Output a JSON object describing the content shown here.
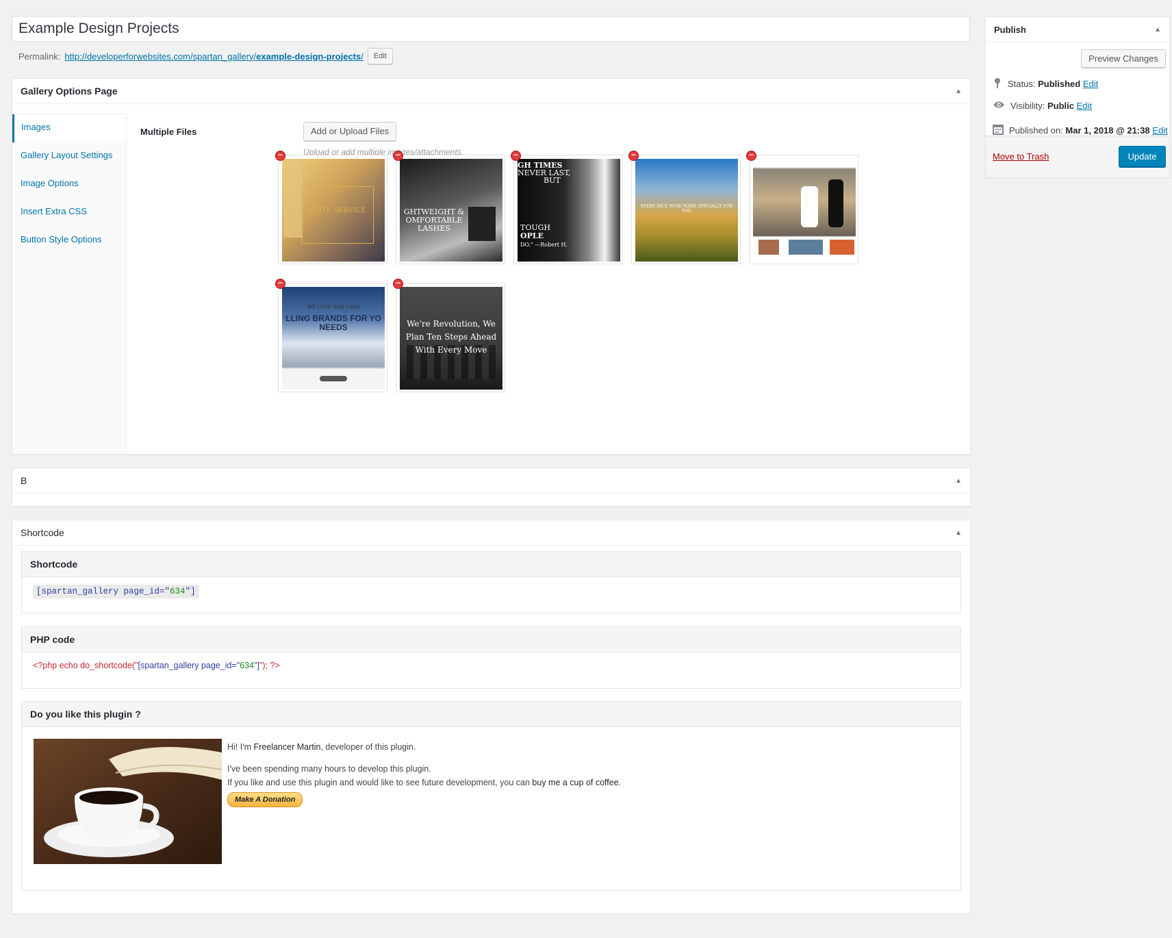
{
  "title_input": {
    "value": "Example Design Projects"
  },
  "permalink": {
    "label": "Permalink:",
    "url_base": "http://developerforwebsites.com/spartan_gallery/",
    "url_slug": "example-design-projects",
    "url_end": "/",
    "edit_label": "Edit"
  },
  "gallery_options": {
    "title": "Gallery Options Page",
    "tabs": [
      {
        "label": "Images"
      },
      {
        "label": "Gallery Layout Settings"
      },
      {
        "label": "Image Options"
      },
      {
        "label": "Insert Extra CSS"
      },
      {
        "label": "Button Style Options"
      }
    ],
    "multiple_files_label": "Multiple Files",
    "add_button": "Add or Upload Files",
    "upload_hint": "Upload or add multiple images/attachments.",
    "thumbnails": [
      {
        "texts": [
          "ELITE SERVICE"
        ],
        "colors": [
          "#d6a14a",
          "#f3d28b"
        ]
      },
      {
        "texts": [
          "GHTWEIGHT &",
          "OMFORTABLE",
          "LASHES"
        ],
        "colors": [
          "#2d2d2d",
          "#6a6a6a"
        ]
      },
      {
        "texts": [
          "GH TIMES",
          "NEVER LAST,",
          "BUT",
          "TOUGH",
          "OPLE",
          "DO.\" —Robert H."
        ],
        "colors": [
          "#111111",
          "#555555"
        ]
      },
      {
        "texts": [
          "EVERY NICE WINE MADE SPECIALLY FOR YOU"
        ],
        "colors": [
          "#2a78c4",
          "#c9a54a"
        ]
      },
      {
        "texts": [],
        "colors": [
          "#7f7a6d",
          "#d7c9a8"
        ]
      },
      {
        "texts": [
          "WE LOVE OUR CARS",
          "LLING BRANDS FOR YO",
          "NEEDS"
        ],
        "colors": [
          "#1e3f73",
          "#f1f1f1"
        ]
      },
      {
        "texts": [
          "We're Revolution, We",
          "Plan Ten Steps Ahead",
          "With Every Move"
        ],
        "colors": [
          "#3a3a3a",
          "#1c1c1c"
        ]
      }
    ]
  },
  "b_box": {
    "title": "B"
  },
  "shortcode_box": {
    "title": "Shortcode",
    "shortcode_title": "Shortcode",
    "shortcode_parts": [
      "[spartan_gallery page_id=\"",
      "634",
      "\"]"
    ],
    "php_title": "PHP code",
    "php_parts": [
      "<?php echo do_shortcode(\"",
      "[spartan_gallery page_id=\"",
      "634",
      "\"]",
      "\"); ?>"
    ],
    "donate_title": "Do you like this plugin ?",
    "donate_line1_pre": "Hi! I'm ",
    "donate_line1_name": "Freelancer Martin",
    "donate_line1_post": ", developer of this plugin.",
    "donate_line2": "I've been spending many hours to develop this plugin.",
    "donate_line3_pre": "If you like and use this plugin and would like to see future development, you can ",
    "donate_line3_bold": "buy me a cup of coffee",
    "donate_line3_post": ".",
    "donate_button": "Make A Donation"
  },
  "publish": {
    "title": "Publish",
    "preview_button": "Preview Changes",
    "status_label": "Status:",
    "status_value": "Published",
    "visibility_label": "Visibility:",
    "visibility_value": "Public",
    "published_label": "Published on:",
    "published_value": "Mar 1, 2018 @ 21:38",
    "edit_label": "Edit",
    "trash_label": "Move to Trash",
    "update_button": "Update"
  },
  "colors": {
    "accent": "#0073aa",
    "primary_button": "#0085ba",
    "trash": "#a00000"
  },
  "icons": [
    "pin-icon",
    "eye-icon",
    "calendar-icon",
    "collapse-arrow-icon",
    "remove-icon"
  ]
}
